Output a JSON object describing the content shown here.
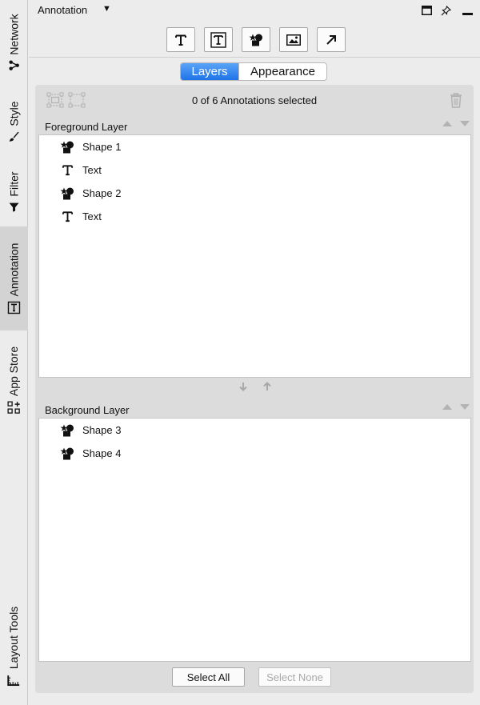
{
  "side_tabs": [
    {
      "label": "Network",
      "icon": "network-icon"
    },
    {
      "label": "Style",
      "icon": "brush-icon"
    },
    {
      "label": "Filter",
      "icon": "filter-icon"
    },
    {
      "label": "Annotation",
      "icon": "text-box-icon",
      "active": true
    },
    {
      "label": "App Store",
      "icon": "app-store-icon"
    },
    {
      "label": "Layout Tools",
      "icon": "ruler-icon"
    }
  ],
  "panel": {
    "title": "Annotation",
    "title_caret": "▼"
  },
  "toolbar": {
    "tools": [
      "text-icon",
      "bounded-text-icon",
      "shape-icon",
      "image-icon",
      "arrow-icon"
    ]
  },
  "tabs": {
    "layers": "Layers",
    "appearance": "Appearance"
  },
  "selection": {
    "status": "0 of 6 Annotations selected"
  },
  "foreground": {
    "title": "Foreground Layer",
    "items": [
      {
        "type": "shape",
        "label": "Shape 1"
      },
      {
        "type": "text",
        "label": "Text"
      },
      {
        "type": "shape",
        "label": "Shape 2"
      },
      {
        "type": "text",
        "label": "Text"
      }
    ]
  },
  "background": {
    "title": "Background Layer",
    "items": [
      {
        "type": "shape",
        "label": "Shape 3"
      },
      {
        "type": "shape",
        "label": "Shape 4"
      }
    ]
  },
  "buttons": {
    "select_all": "Select All",
    "select_none": "Select None"
  },
  "colors": {
    "accent": "#1f74e8",
    "panel_bg": "#ececec",
    "content_bg": "#dcdcdc"
  }
}
